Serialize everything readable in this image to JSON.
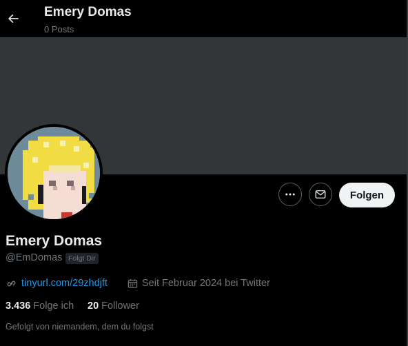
{
  "header": {
    "back_icon": "arrow-left-icon",
    "title": "Emery Domas",
    "posts_count": "0 Posts"
  },
  "profile": {
    "display_name": "Emery Domas",
    "handle": "@EmDomas",
    "follows_you_badge": "Folgt Dir",
    "website_icon": "link-icon",
    "website": "tinyurl.com/29zhdjft",
    "joined_icon": "calendar-icon",
    "joined": "Seit Februar 2024 bei Twitter",
    "following_count": "3.436",
    "following_label": "Folge ich",
    "followers_count": "20",
    "followers_label": "Follower",
    "followed_by": "Gefolgt von niemandem, dem du folgst"
  },
  "actions": {
    "more_icon": "more-dots-icon",
    "message_icon": "envelope-icon",
    "follow_label": "Folgen"
  },
  "colors": {
    "background": "#000000",
    "banner": "#333639",
    "link": "#1d9bf0",
    "secondary_text": "#71767b",
    "primary_text": "#e7e9ea",
    "follow_button_bg": "#eff3f4"
  }
}
